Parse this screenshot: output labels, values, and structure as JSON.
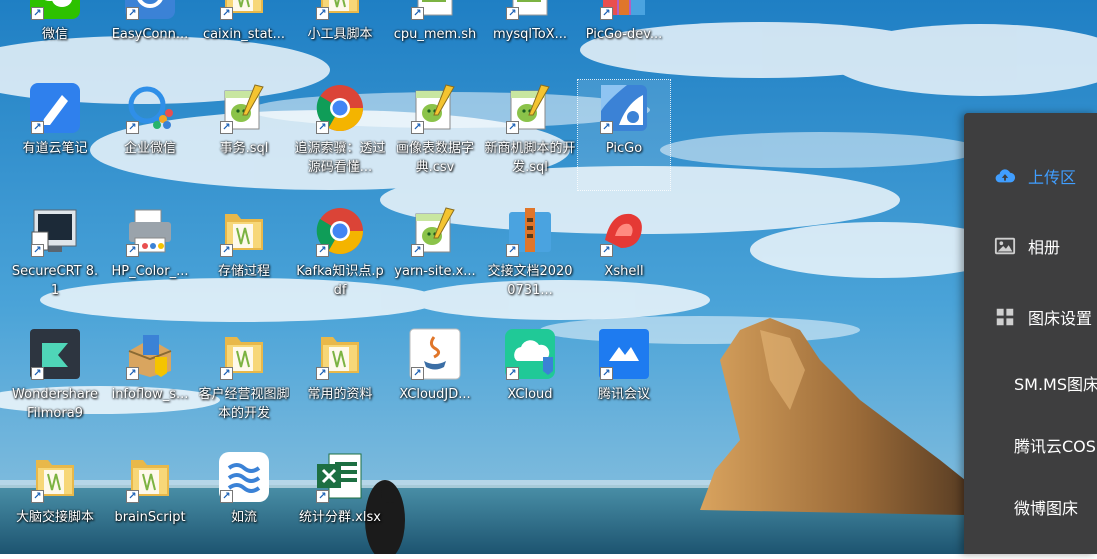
{
  "desktop": {
    "icons": [
      {
        "label": "微信",
        "icon": "wechat-icon"
      },
      {
        "label": "EasyConn...",
        "icon": "easyconnect-icon"
      },
      {
        "label": "caixin_stat...",
        "icon": "folder-icon"
      },
      {
        "label": "小工具脚本",
        "icon": "folder-icon"
      },
      {
        "label": "cpu_mem.sh",
        "icon": "script-icon"
      },
      {
        "label": "mysqlToX...",
        "icon": "script-icon"
      },
      {
        "label": "PicGo-dev...",
        "icon": "archive-icon"
      },
      {
        "label": "有道云笔记",
        "icon": "youdao-note-icon"
      },
      {
        "label": "企业微信",
        "icon": "wecom-icon"
      },
      {
        "label": "事务.sql",
        "icon": "notepadpp-file-icon"
      },
      {
        "label": "追源索骥：透过源码看懂...",
        "icon": "chrome-icon"
      },
      {
        "label": "画像表数据字典.csv",
        "icon": "notepadpp-file-icon"
      },
      {
        "label": "新商机脚本的开发.sql",
        "icon": "notepadpp-file-icon"
      },
      {
        "label": "PicGo",
        "icon": "picgo-icon"
      },
      {
        "label": "SecureCRT 8.1",
        "icon": "securecrt-icon"
      },
      {
        "label": "HP_Color_...",
        "icon": "printer-icon"
      },
      {
        "label": "存储过程",
        "icon": "folder-icon"
      },
      {
        "label": "Kafka知识点.pdf",
        "icon": "chrome-icon"
      },
      {
        "label": "yarn-site.x...",
        "icon": "notepadpp-file-icon"
      },
      {
        "label": "交接文档20200731...",
        "icon": "winrar-icon"
      },
      {
        "label": "Xshell",
        "icon": "xshell-icon"
      },
      {
        "label": "Wondershare Filmora9",
        "icon": "filmora-icon"
      },
      {
        "label": "infoflow_s...",
        "icon": "installer-icon"
      },
      {
        "label": "客户经营视图脚本的开发",
        "icon": "folder-icon"
      },
      {
        "label": "常用的资料",
        "icon": "folder-icon"
      },
      {
        "label": "XCloudJD...",
        "icon": "java-icon"
      },
      {
        "label": "XCloud",
        "icon": "xcloud-icon"
      },
      {
        "label": "腾讯会议",
        "icon": "tencent-meeting-icon"
      },
      {
        "label": "大脑交接脚本",
        "icon": "folder-icon"
      },
      {
        "label": "brainScript",
        "icon": "folder-icon"
      },
      {
        "label": "如流",
        "icon": "ruliu-icon"
      },
      {
        "label": "统计分群.xlsx",
        "icon": "excel-icon"
      }
    ]
  },
  "picgo_panel": {
    "items": [
      {
        "label": "上传区",
        "icon": "cloud-upload-icon",
        "active": true
      },
      {
        "label": "相册",
        "icon": "image-icon",
        "active": false
      },
      {
        "label": "图床设置",
        "icon": "grid-icon",
        "active": false
      },
      {
        "label": "SM.MS图床",
        "icon": "",
        "active": false
      },
      {
        "label": "腾讯云COS",
        "icon": "",
        "active": false
      },
      {
        "label": "微博图床",
        "icon": "",
        "active": false
      }
    ],
    "accent_color": "#409eff",
    "background_color": "#3e3e3f"
  },
  "wallpaper": {
    "sky_color": "#2f8fd0",
    "sea_color": "#1f6b8c",
    "rock_color": "#b7854a"
  }
}
